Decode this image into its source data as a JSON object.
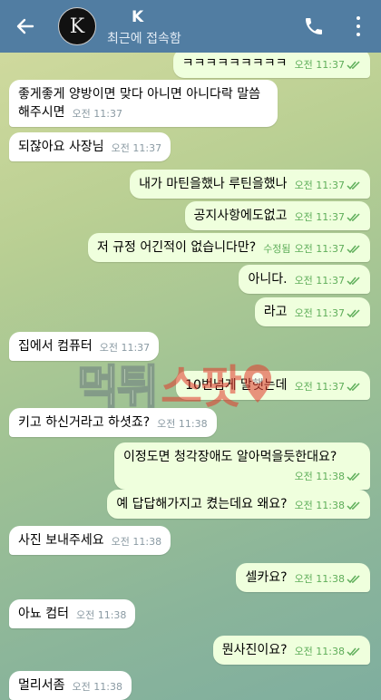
{
  "header": {
    "back_icon": "arrow-left-icon",
    "avatar_letter": "K",
    "name": "K",
    "status": "최근에 접속함",
    "call_icon": "phone-icon",
    "menu_icon": "more-vertical-icon",
    "header_color": "#517da2"
  },
  "messages": [
    {
      "dir": "out",
      "text": "ㅋㅋㅋㅋㅋㅋㅋㅋㅋ",
      "time": "오전 11:37",
      "edited": "",
      "read": true
    },
    {
      "dir": "in",
      "text": "좋게좋게 양방이면 맞다 아니면 아니다락 말씀\n해주시면",
      "time": "오전 11:37",
      "edited": "",
      "read": false
    },
    {
      "dir": "in",
      "text": "되잖아요 사장님",
      "time": "오전 11:37",
      "edited": "",
      "read": false
    },
    {
      "dir": "out",
      "text": "내가 마틴을했나 루틴을했나",
      "time": "오전 11:37",
      "edited": "",
      "read": true
    },
    {
      "dir": "out",
      "text": "공지사항에도없고",
      "time": "오전 11:37",
      "edited": "",
      "read": true
    },
    {
      "dir": "out",
      "text": "저 규정 어긴적이 없습니다만?",
      "time": "오전 11:37",
      "edited": "수정됨",
      "read": true
    },
    {
      "dir": "out",
      "text": "아니다.",
      "time": "오전 11:37",
      "edited": "",
      "read": true
    },
    {
      "dir": "out",
      "text": "라고",
      "time": "오전 11:37",
      "edited": "",
      "read": true
    },
    {
      "dir": "in",
      "text": "집에서 컴퓨터",
      "time": "오전 11:37",
      "edited": "",
      "read": false
    },
    {
      "dir": "out",
      "text": "10번넘게 말햇는데",
      "time": "오전 11:37",
      "edited": "",
      "read": true
    },
    {
      "dir": "in",
      "text": "키고 하신거라고 하셧죠?",
      "time": "오전 11:38",
      "edited": "",
      "read": false
    },
    {
      "dir": "out",
      "text": "이정도면 청각장애도 알아먹을듯한대요?",
      "time": "오전 11:38",
      "edited": "",
      "read": true
    },
    {
      "dir": "out",
      "text": "예 답답해가지고 켰는데요 왜요?",
      "time": "오전 11:38",
      "edited": "",
      "read": true
    },
    {
      "dir": "in",
      "text": "사진 보내주세요",
      "time": "오전 11:38",
      "edited": "",
      "read": false
    },
    {
      "dir": "out",
      "text": "셀카요?",
      "time": "오전 11:38",
      "edited": "",
      "read": true
    },
    {
      "dir": "in",
      "text": "아뇨 컴터",
      "time": "오전 11:38",
      "edited": "",
      "read": false
    },
    {
      "dir": "out",
      "text": "뭔사진이요?",
      "time": "오전 11:38",
      "edited": "",
      "read": true
    },
    {
      "dir": "in",
      "text": "멀리서좀",
      "time": "오전 11:38",
      "edited": "",
      "read": false
    }
  ],
  "watermark": {
    "part1": "먹튀",
    "part2": "스팟"
  },
  "colors": {
    "incoming": "#ffffff",
    "outgoing": "#efffdd",
    "time_out": "#5fae5a"
  }
}
